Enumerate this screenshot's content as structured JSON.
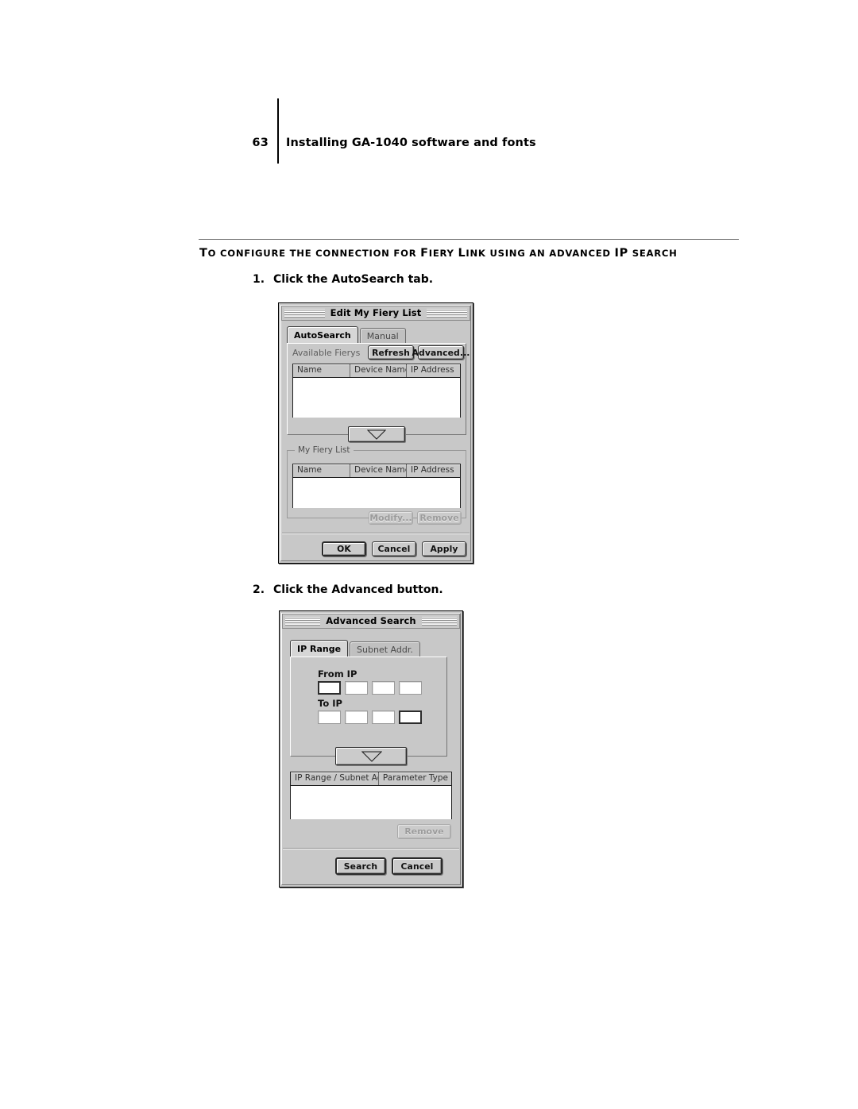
{
  "page": {
    "folio": "63",
    "running_head": "Installing GA-1040 software and fonts",
    "procedure_title_parts": {
      "t1": "T",
      "t2": "O CONFIGURE THE CONNECTION FOR ",
      "t3": "F",
      "t4": "IERY ",
      "t5": "L",
      "t6": "INK USING AN ADVANCED ",
      "t7": "IP",
      "t8": " SEARCH"
    },
    "procedure_title_plain": "TO CONFIGURE THE CONNECTION FOR FIERY LINK USING AN ADVANCED IP SEARCH"
  },
  "steps": [
    {
      "num": "1.",
      "text": "Click the AutoSearch tab."
    },
    {
      "num": "2.",
      "text": "Click the Advanced button."
    }
  ],
  "dialog_edit_my_fiery_list": {
    "title": "Edit My Fiery List",
    "tabs": [
      {
        "label": "AutoSearch",
        "active": true
      },
      {
        "label": "Manual",
        "active": false
      }
    ],
    "available_label": "Available Fierys",
    "refresh_button": "Refresh",
    "advanced_button": "Advanced...",
    "available_table": {
      "columns": [
        "Name",
        "Device Name",
        "IP Address"
      ],
      "rows": []
    },
    "move_down_icon": "triangle-down-icon",
    "group_label": "My Fiery List",
    "my_list_table": {
      "columns": [
        "Name",
        "Device Name",
        "IP Address"
      ],
      "rows": []
    },
    "modify_button": "Modify...",
    "remove_button": "Remove",
    "ok_button": "OK",
    "cancel_button": "Cancel",
    "apply_button": "Apply"
  },
  "dialog_advanced_search": {
    "title": "Advanced Search",
    "tabs": [
      {
        "label": "IP Range",
        "active": true
      },
      {
        "label": "Subnet Addr.",
        "active": false
      }
    ],
    "from_ip_label": "From IP",
    "to_ip_label": "To IP",
    "from_ip_octets": [
      "",
      "",
      "",
      ""
    ],
    "to_ip_octets": [
      "",
      "",
      "",
      ""
    ],
    "add_down_icon": "triangle-down-icon",
    "result_table": {
      "columns": [
        "IP Range / Subnet Addr",
        "Parameter Type"
      ],
      "rows": []
    },
    "remove_button": "Remove",
    "search_button": "Search",
    "cancel_button": "Cancel"
  },
  "colors": {
    "dialog_face": "#c8c8c8",
    "dialog_border": "#000000",
    "list_background": "#ffffff",
    "disabled_text": "#9b9b9b",
    "rule": "#6f6f6f"
  }
}
